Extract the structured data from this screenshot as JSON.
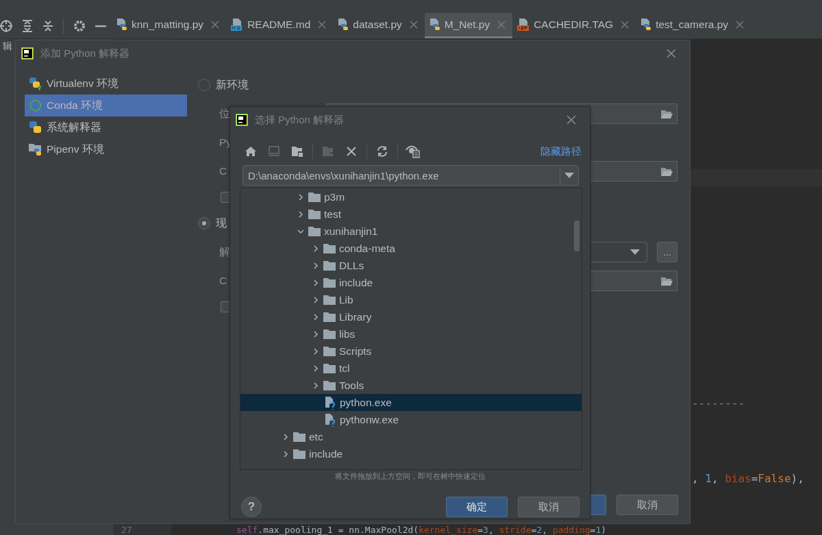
{
  "side_panel": {
    "edge_label": "辑"
  },
  "tabs": [
    {
      "label": "knn_matting.py",
      "kind": "python",
      "selected": false
    },
    {
      "label": "README.md",
      "kind": "markdown",
      "selected": false
    },
    {
      "label": "dataset.py",
      "kind": "python",
      "selected": false
    },
    {
      "label": "M_Net.py",
      "kind": "python",
      "selected": true
    },
    {
      "label": "CACHEDIR.TAG",
      "kind": "jsp",
      "selected": false
    },
    {
      "label": "test_camera.py",
      "kind": "python",
      "selected": false
    }
  ],
  "editor": {
    "line_number": "27",
    "lines": [
      {
        "tokens": [
          {
            "text": "--------",
            "kind": "comment"
          }
        ]
      },
      {
        "tokens": [
          {
            "text": ", ",
            "kind": "plain"
          },
          {
            "text": "1",
            "kind": "number"
          },
          {
            "text": ", ",
            "kind": "plain"
          },
          {
            "text": "bias",
            "kind": "param"
          },
          {
            "text": "=",
            "kind": "plain"
          },
          {
            "text": "False",
            "kind": "keyword"
          },
          {
            "text": "),",
            "kind": "plain"
          }
        ]
      },
      {
        "tokens": [
          {
            "text": "self",
            "kind": "self"
          },
          {
            "text": ".max_pooling_1 = nn.MaxPool2d(",
            "kind": "plain"
          },
          {
            "text": "kernel_size",
            "kind": "param"
          },
          {
            "text": "=",
            "kind": "plain"
          },
          {
            "text": "3",
            "kind": "number"
          },
          {
            "text": ", ",
            "kind": "plain"
          },
          {
            "text": "stride",
            "kind": "param"
          },
          {
            "text": "=",
            "kind": "plain"
          },
          {
            "text": "2",
            "kind": "number"
          },
          {
            "text": ", ",
            "kind": "plain"
          },
          {
            "text": "padding",
            "kind": "param"
          },
          {
            "text": "=",
            "kind": "plain"
          },
          {
            "text": "1",
            "kind": "number"
          },
          {
            "text": ")",
            "kind": "plain"
          }
        ]
      }
    ]
  },
  "add_dialog": {
    "title": "添加 Python 解释器",
    "env_types": [
      {
        "label": "Virtualenv 环境",
        "kind": "virtualenv",
        "selected": false
      },
      {
        "label": "Conda 环境",
        "kind": "conda",
        "selected": true
      },
      {
        "label": "系统解释器",
        "kind": "system",
        "selected": false
      },
      {
        "label": "Pipenv 环境",
        "kind": "pipenv",
        "selected": false
      }
    ],
    "options": [
      {
        "label": "新环境",
        "selected": false,
        "fields": [
          {
            "label": "位",
            "kind": "browse"
          },
          {
            "label": "Py",
            "kind": "blank"
          },
          {
            "label": "C",
            "kind": "browse"
          }
        ],
        "checkbox": {
          "checked": false
        }
      },
      {
        "label": "现",
        "selected": true,
        "fields": [
          {
            "label": "解",
            "kind": "dropdown",
            "more": "..."
          },
          {
            "label": "C",
            "kind": "browse"
          }
        ],
        "checkbox": {
          "checked": false
        }
      }
    ],
    "buttons": [
      {
        "kind": "primary"
      },
      {
        "label": "取消",
        "kind": "secondary"
      }
    ]
  },
  "select_dialog": {
    "title": "选择 Python 解释器",
    "toolbar": [
      {
        "kind": "home",
        "disabled": false
      },
      {
        "kind": "desktop",
        "disabled": true
      },
      {
        "kind": "project",
        "disabled": false
      },
      {
        "kind": "separator"
      },
      {
        "kind": "new-folder",
        "disabled": true
      },
      {
        "kind": "delete",
        "disabled": false
      },
      {
        "kind": "separator"
      },
      {
        "kind": "refresh",
        "disabled": false
      },
      {
        "kind": "separator"
      },
      {
        "kind": "show-hidden",
        "disabled": false
      }
    ],
    "hide_path_link": "隐藏路径",
    "path": "D:\\anaconda\\envs\\xunihanjin1\\python.exe",
    "tree": {
      "nested_rows": [
        {
          "name": "p3m",
          "kind": "folder",
          "expanded": false,
          "selected": false
        },
        {
          "name": "test",
          "kind": "folder",
          "expanded": false,
          "selected": false
        },
        {
          "name": "xunihanjin1",
          "kind": "folder",
          "expanded": true,
          "selected": false,
          "children": [
            {
              "name": "conda-meta",
              "kind": "folder",
              "expanded": false,
              "selected": false
            },
            {
              "name": "DLLs",
              "kind": "folder",
              "expanded": false,
              "selected": false
            },
            {
              "name": "include",
              "kind": "folder",
              "expanded": false,
              "selected": false
            },
            {
              "name": "Lib",
              "kind": "folder",
              "expanded": false,
              "selected": false
            },
            {
              "name": "Library",
              "kind": "folder",
              "expanded": false,
              "selected": false
            },
            {
              "name": "libs",
              "kind": "folder",
              "expanded": false,
              "selected": false
            },
            {
              "name": "Scripts",
              "kind": "folder",
              "expanded": false,
              "selected": false
            },
            {
              "name": "tcl",
              "kind": "folder",
              "expanded": false,
              "selected": false
            },
            {
              "name": "Tools",
              "kind": "folder",
              "expanded": false,
              "selected": false
            },
            {
              "name": "python.exe",
              "kind": "file",
              "selected": true
            },
            {
              "name": "pythonw.exe",
              "kind": "file",
              "selected": false
            }
          ]
        }
      ],
      "rows": [
        {
          "name": "etc",
          "kind": "folder",
          "expanded": false,
          "selected": false
        },
        {
          "name": "include",
          "kind": "folder",
          "expanded": false,
          "selected": false
        }
      ]
    },
    "hint": "将文件拖放到上方空间，即可在树中快速定位",
    "help": "?",
    "buttons": [
      {
        "label": "确定",
        "kind": "primary"
      },
      {
        "label": "取消",
        "kind": "secondary"
      }
    ]
  }
}
